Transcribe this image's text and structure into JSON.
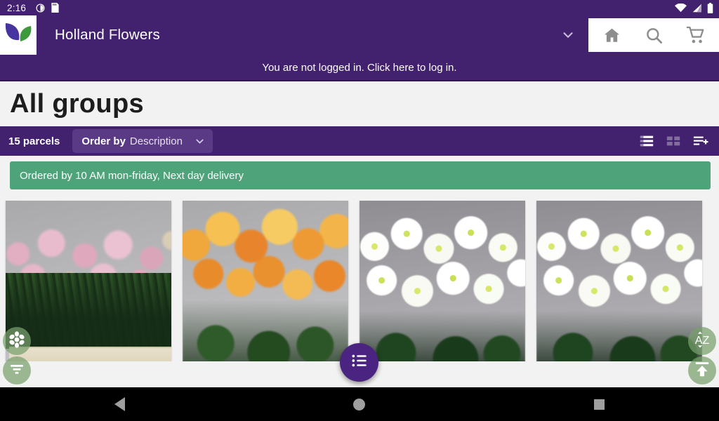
{
  "statusbar": {
    "clock": "2:16",
    "left_icons": [
      "contrast-icon",
      "sdcard-icon"
    ],
    "right_icons": [
      "wifi-icon",
      "signal-icon",
      "battery-icon"
    ]
  },
  "appbar": {
    "logo": "leaf-logo",
    "title": "Holland Flowers",
    "dropdown_icon": "chevron-down-icon",
    "actions": [
      {
        "name": "home-icon",
        "label": "Home"
      },
      {
        "name": "search-icon",
        "label": "Search"
      },
      {
        "name": "cart-icon",
        "label": "Cart"
      }
    ]
  },
  "login_notice": {
    "text": "You are not logged in. Click here to log in."
  },
  "page": {
    "title": "All groups"
  },
  "toolbar": {
    "count_label": "15 parcels",
    "order_by_label": "Order by",
    "order_by_value": "Description",
    "chevron_icon": "chevron-down-icon",
    "view_icons": [
      {
        "name": "list-view-icon",
        "active": true
      },
      {
        "name": "grid-view-icon",
        "active": false
      },
      {
        "name": "playlist-add-icon",
        "active": true
      }
    ]
  },
  "notice": {
    "text": "Ordered by 10 AM mon-friday, Next day delivery",
    "color": "#4fa37b"
  },
  "products": [
    {
      "name": "product-card-1",
      "photo": "pink-yarrow-in-tray"
    },
    {
      "name": "product-card-2",
      "photo": "orange-chrysanthemums"
    },
    {
      "name": "product-card-3",
      "photo": "white-chrysanthemums"
    },
    {
      "name": "product-card-4",
      "photo": "white-chrysanthemums-bunch"
    }
  ],
  "fabs": [
    {
      "name": "settings-fab",
      "icon": "flower-gear-icon"
    },
    {
      "name": "filter-fab",
      "icon": "filter-funnel-icon"
    },
    {
      "name": "list-fab",
      "icon": "list-icon"
    },
    {
      "name": "sort-az-fab",
      "icon": "sort-az-icon",
      "label": "AZ"
    },
    {
      "name": "scroll-top-fab",
      "icon": "arrow-up-icon"
    }
  ],
  "navbar": {
    "back": "back-triangle-icon",
    "home": "home-circle-icon",
    "recents": "recents-square-icon"
  },
  "colors": {
    "primary": "#42216e",
    "primary_light": "#5a3a84",
    "accent_green": "#4fa37b",
    "page_bg": "#f1f2f1"
  }
}
